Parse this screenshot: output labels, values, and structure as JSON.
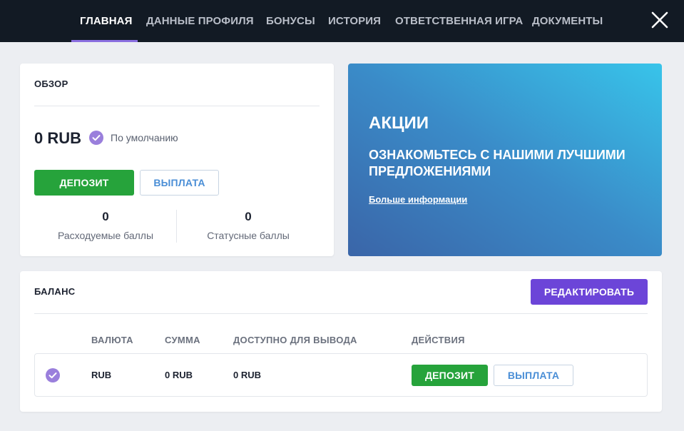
{
  "nav": {
    "tabs": [
      {
        "label": "ГЛАВНАЯ",
        "active": true
      },
      {
        "label": "ДАННЫЕ ПРОФИЛЯ",
        "active": false
      },
      {
        "label": "БОНУСЫ",
        "active": false
      },
      {
        "label": "ИСТОРИЯ",
        "active": false
      },
      {
        "label": "ОТВЕТСТВЕННАЯ ИГРА",
        "active": false
      },
      {
        "label": "ДОКУМЕНТЫ",
        "active": false
      }
    ],
    "close_icon": "close-icon"
  },
  "overview": {
    "title": "ОБЗОР",
    "amount": "0 RUB",
    "default_label": "По умолчанию",
    "deposit_label": "ДЕПОЗИТ",
    "withdraw_label": "ВЫПЛАТА",
    "spendable_points": "0",
    "spendable_points_label": "Расходуемые баллы",
    "status_points": "0",
    "status_points_label": "Статусные баллы"
  },
  "promo": {
    "title": "АКЦИИ",
    "subtitle": "ОЗНАКОМЬТЕСЬ С НАШИМИ ЛУЧШИМИ ПРЕДЛОЖЕНИЯМИ",
    "link": "Больше информации"
  },
  "balance": {
    "title": "БАЛАНС",
    "edit_label": "РЕДАКТИРОВАТЬ",
    "columns": [
      "ВАЛЮТА",
      "СУММА",
      "ДОСТУПНО ДЛЯ ВЫВОДА",
      "ДЕЙСТВИЯ"
    ],
    "rows": [
      {
        "currency": "RUB",
        "amount": "0 RUB",
        "available": "0 RUB",
        "deposit_label": "ДЕПОЗИТ",
        "withdraw_label": "ВЫПЛАТА"
      }
    ]
  },
  "colors": {
    "topbar": "#121a24",
    "accent_purple": "#6c45d8",
    "check_purple": "#9a7fdc",
    "green": "#26a33b",
    "link_blue": "#4a8ed6"
  }
}
